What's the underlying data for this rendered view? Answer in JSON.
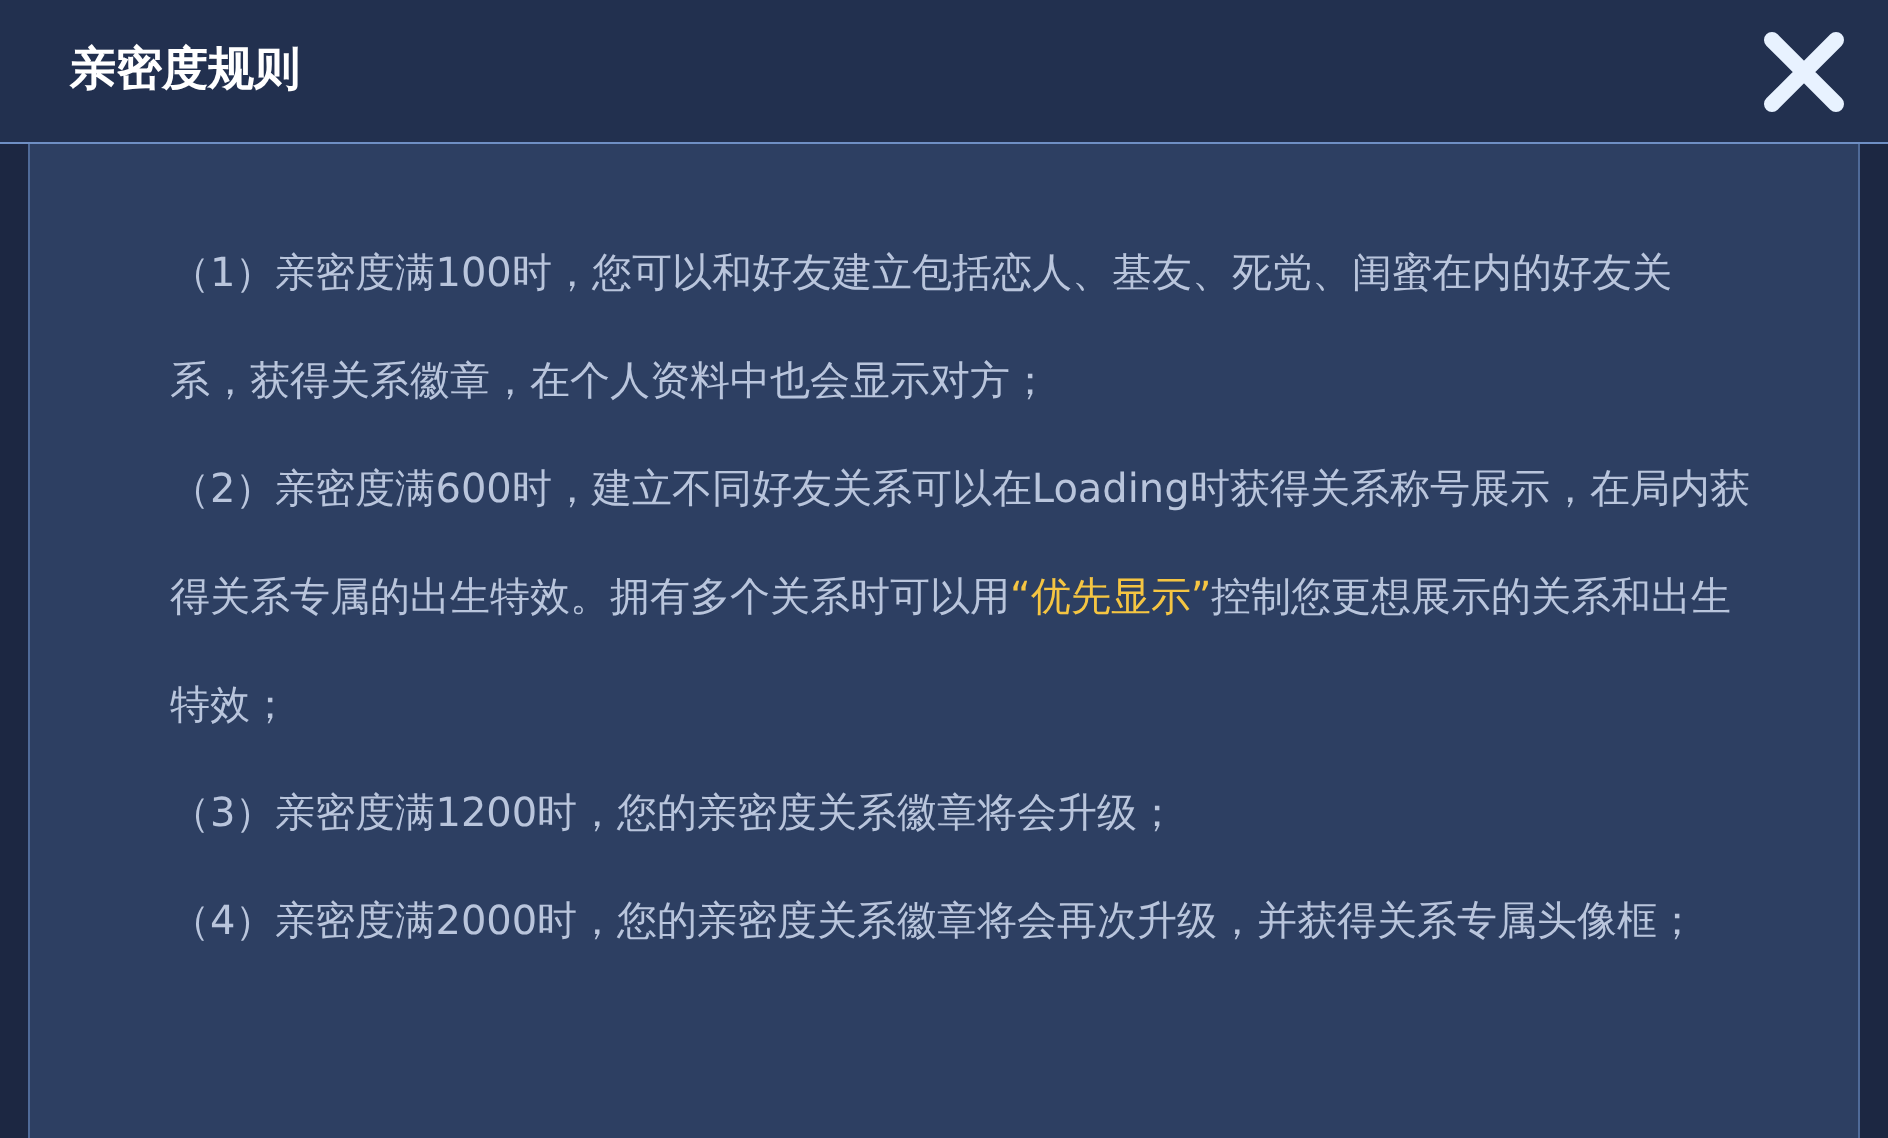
{
  "dialog": {
    "title": "亲密度规则"
  },
  "rules": [
    {
      "segments": [
        {
          "text": "（1）亲密度满100时，您可以和好友建立包括恋人、基友、死党、闺蜜在内的好友关系，获得关系徽章，在个人资料中也会显示对方；",
          "highlight": false
        }
      ]
    },
    {
      "segments": [
        {
          "text": "（2）亲密度满600时，建立不同好友关系可以在Loading时获得关系称号展示，在局内获得关系专属的出生特效。拥有多个关系时可以用",
          "highlight": false
        },
        {
          "text": "“优先显示”",
          "highlight": true
        },
        {
          "text": "控制您更想展示的关系和出生特效；",
          "highlight": false
        }
      ]
    },
    {
      "segments": [
        {
          "text": "（3）亲密度满1200时，您的亲密度关系徽章将会升级；",
          "highlight": false
        }
      ]
    },
    {
      "segments": [
        {
          "text": "（4）亲密度满2000时，您的亲密度关系徽章将会再次升级，并获得关系专属头像框；",
          "highlight": false
        }
      ]
    }
  ]
}
